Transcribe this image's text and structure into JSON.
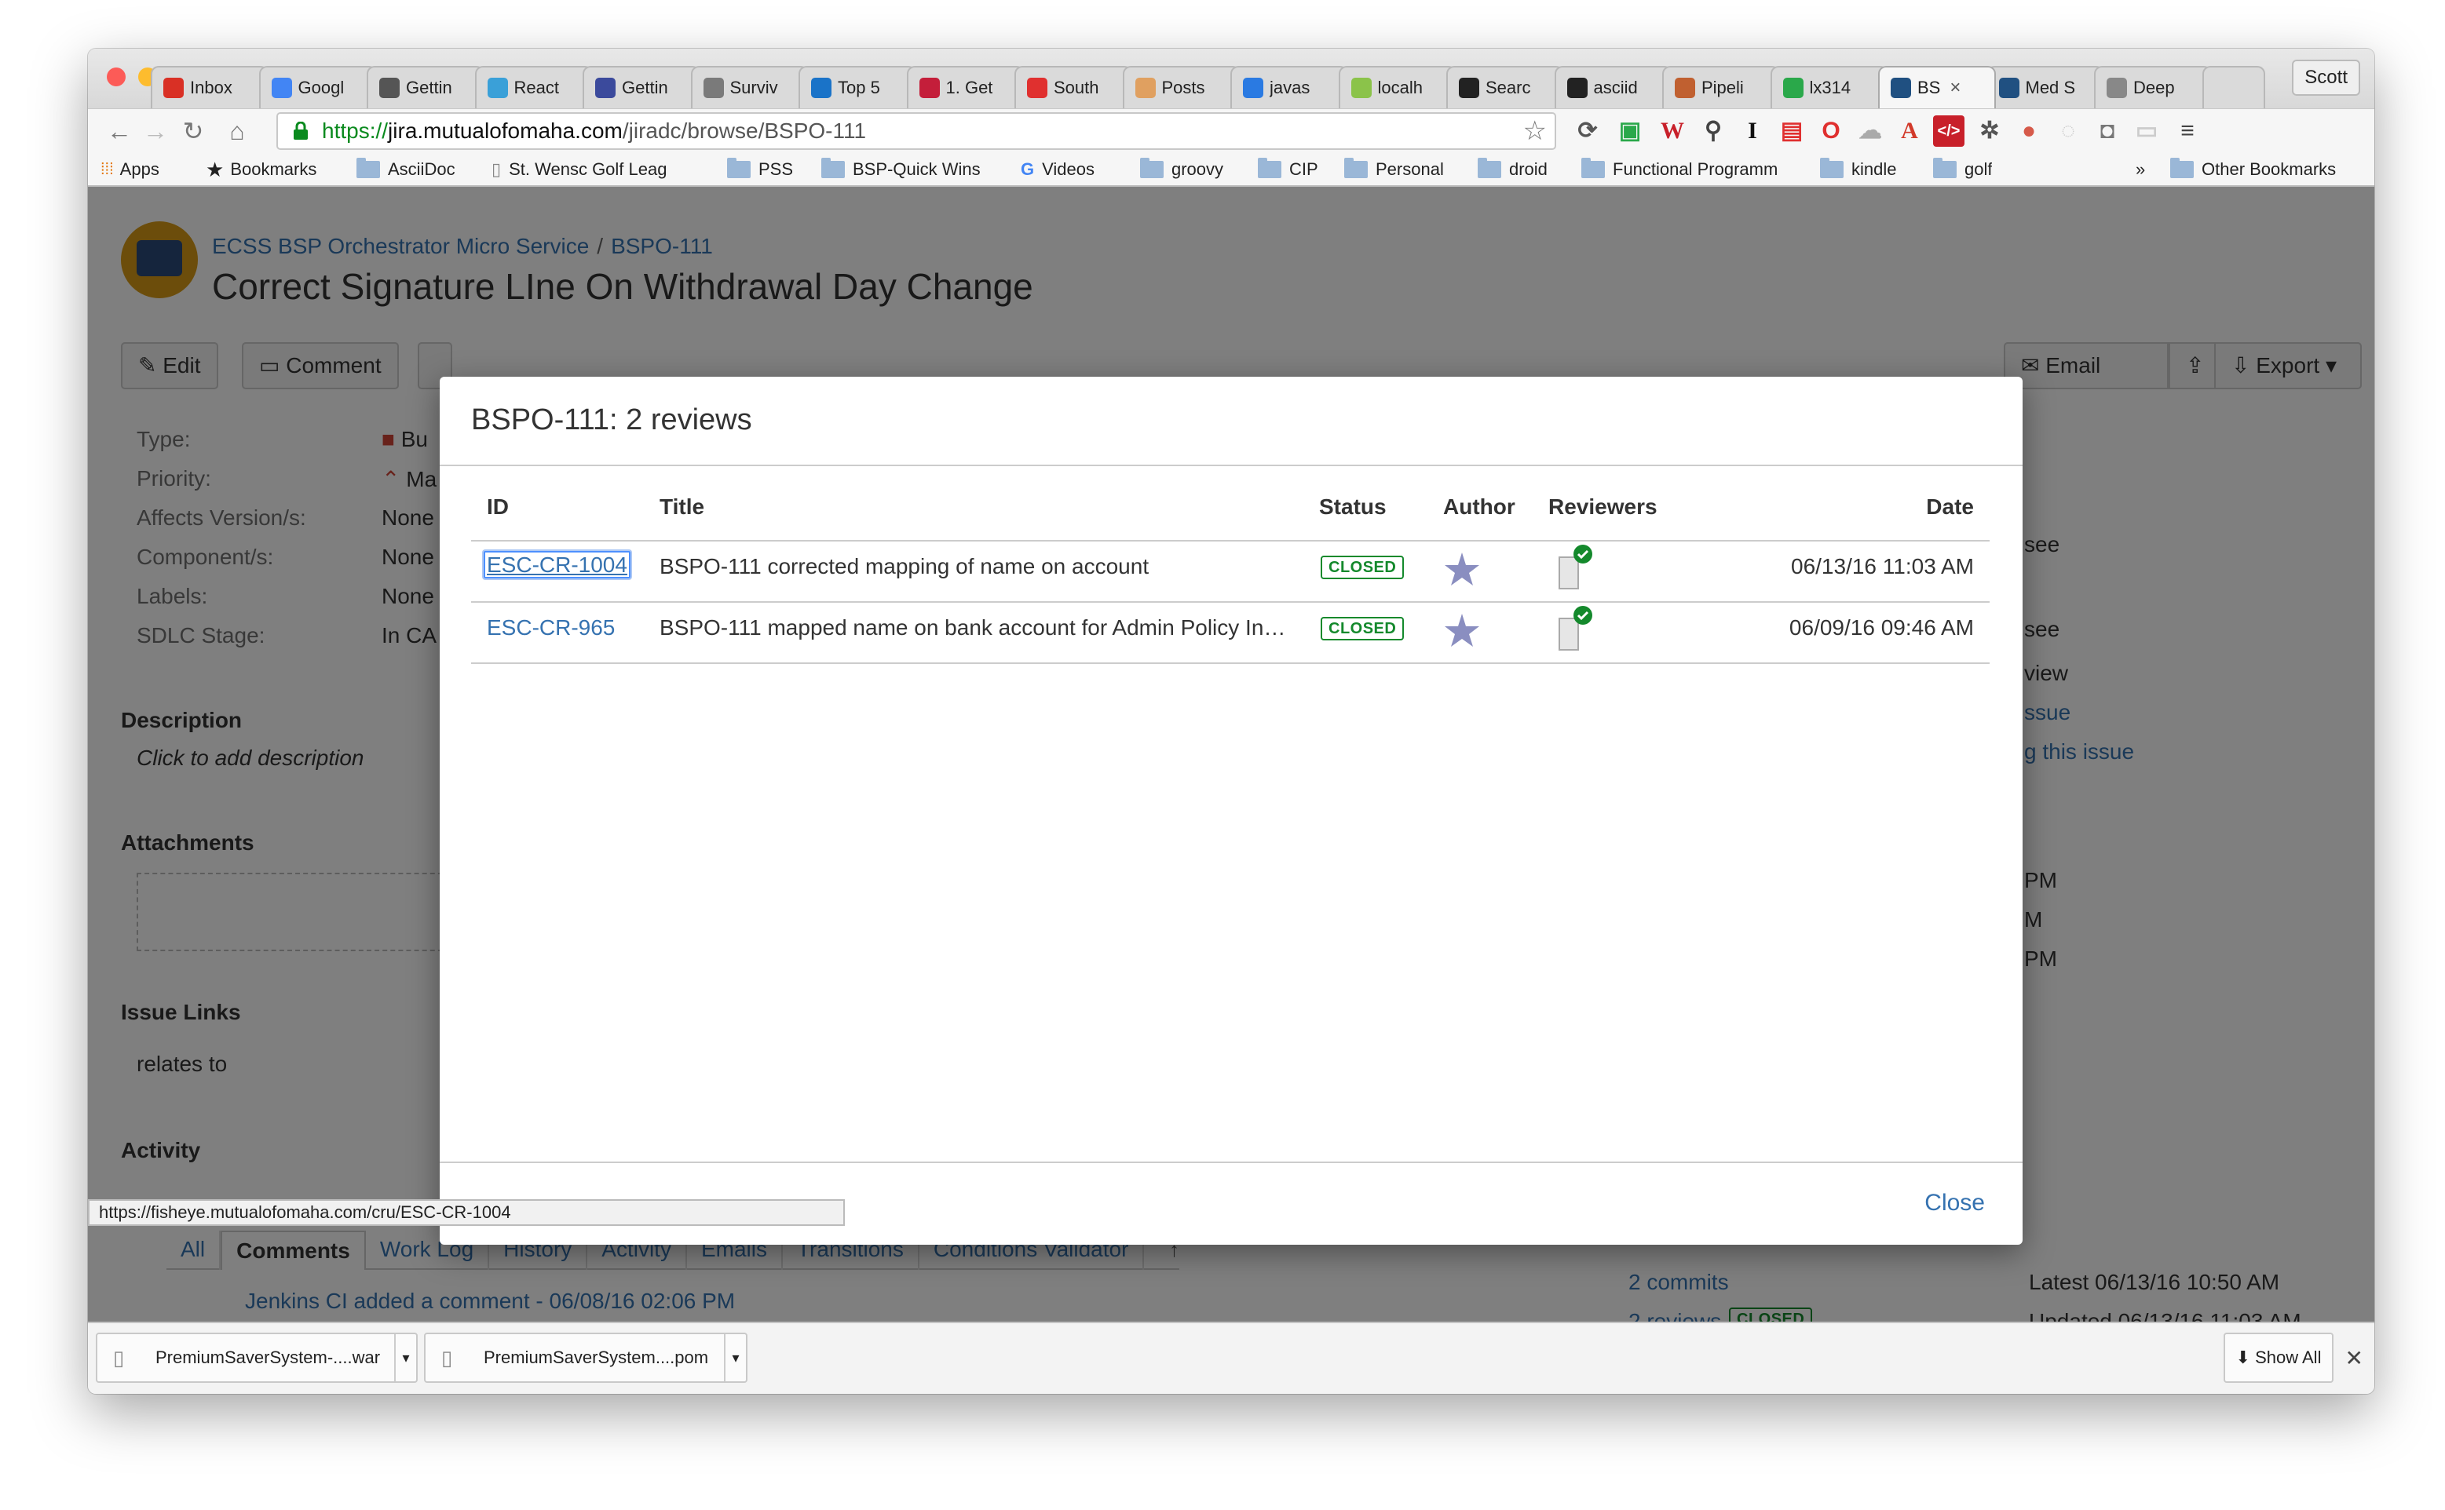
{
  "browser": {
    "profile_name": "Scott",
    "tabs": [
      {
        "label": "Inbox",
        "icon": "gmail-icon",
        "color": "#d93025"
      },
      {
        "label": "Googl",
        "icon": "calendar-icon",
        "color": "#4285f4"
      },
      {
        "label": "Gettin",
        "icon": "glasses-icon",
        "color": "#555555"
      },
      {
        "label": "React",
        "icon": "react-icon",
        "color": "#3aa0d8"
      },
      {
        "label": "Gettin",
        "icon": "s-icon",
        "color": "#3b4a9c"
      },
      {
        "label": "Surviv",
        "icon": "circle-icon",
        "color": "#7a7a7a"
      },
      {
        "label": "Top 5",
        "icon": "bird-icon",
        "color": "#1a73c8"
      },
      {
        "label": "1. Get",
        "icon": "dr-icon",
        "color": "#c41e3a"
      },
      {
        "label": "South",
        "icon": "heart-icon",
        "color": "#e0302f"
      },
      {
        "label": "Posts",
        "icon": "post-icon",
        "color": "#e0a060"
      },
      {
        "label": "javas",
        "icon": "f-icon",
        "color": "#2a7ae2"
      },
      {
        "label": "localh",
        "icon": "leaf-icon",
        "color": "#8bc34a"
      },
      {
        "label": "Searc",
        "icon": "github-icon",
        "color": "#222222"
      },
      {
        "label": "asciid",
        "icon": "github-icon",
        "color": "#222222"
      },
      {
        "label": "Pipeli",
        "icon": "jenkins-icon",
        "color": "#c06030"
      },
      {
        "label": "lx314",
        "icon": "ring-icon",
        "color": "#2aa84a"
      },
      {
        "label": "BS",
        "icon": "jira-icon",
        "color": "#205081",
        "active": true
      },
      {
        "label": "Med S",
        "icon": "globe-icon",
        "color": "#205081"
      },
      {
        "label": "Deep",
        "icon": "page-icon",
        "color": "#888888"
      }
    ],
    "url": {
      "protocol": "https://",
      "host": "jira.mutualofomaha.com",
      "path": "/jiradc/browse/BSPO-111"
    },
    "bookmarks": [
      "Apps",
      "Bookmarks",
      "AsciiDoc",
      "St. Wensc Golf Leag",
      "PSS",
      "BSP-Quick Wins",
      "Videos",
      "groovy",
      "CIP",
      "Personal",
      "droid",
      "Functional Programm",
      "kindle",
      "golf",
      "»",
      "Other Bookmarks"
    ],
    "status_url": "https://fisheye.mutualofomaha.com/cru/ESC-CR-1004"
  },
  "issue": {
    "project": "ECSS BSP Orchestrator Micro Service",
    "key": "BSPO-111",
    "title": "Correct Signature LIne On Withdrawal Day Change",
    "buttons": {
      "edit": "Edit",
      "comment": "Comment",
      "email": "Email",
      "export": "Export"
    },
    "fields": [
      {
        "label": "Type:",
        "value": "Bu"
      },
      {
        "label": "Priority:",
        "value": "Ma"
      },
      {
        "label": "Affects Version/s:",
        "value": "None"
      },
      {
        "label": "Component/s:",
        "value": "None"
      },
      {
        "label": "Labels:",
        "value": "None"
      },
      {
        "label": "SDLC Stage:",
        "value": "In CA"
      }
    ],
    "description_heading": "Description",
    "description_placeholder": "Click to add description",
    "attachments_heading": "Attachments",
    "issue_links_heading": "Issue Links",
    "relates_to": "relates to",
    "activity_heading": "Activity",
    "activity_tabs": [
      "All",
      "Comments",
      "Work Log",
      "History",
      "Activity",
      "Emails",
      "Transitions",
      "Conditions Validator"
    ],
    "activity_selected": "Comments",
    "comment_preview": "Jenkins CI added a comment - 06/08/16 02:06 PM",
    "right_panel": {
      "frag_see1": "see",
      "frag_see2": "see",
      "frag_view": "view",
      "frag_issue": "ssue",
      "frag_thisissue": "g this issue",
      "frag_pm1": "PM",
      "frag_m": "M",
      "frag_pm2": "PM",
      "commits": "2 commits",
      "reviews": "2 reviews",
      "reviews_status": "CLOSED",
      "latest": "Latest 06/13/16 10:50 AM",
      "updated": "Updated 06/13/16 11:03 AM"
    }
  },
  "dialog": {
    "title": "BSPO-111: 2 reviews",
    "columns": {
      "id": "ID",
      "title": "Title",
      "status": "Status",
      "author": "Author",
      "reviewers": "Reviewers",
      "date": "Date"
    },
    "rows": [
      {
        "id": "ESC-CR-1004",
        "title": "BSPO-111 corrected mapping of name on account",
        "status": "CLOSED",
        "date": "06/13/16 11:03 AM"
      },
      {
        "id": "ESC-CR-965",
        "title": "BSPO-111 mapped name on bank account for Admin Policy In…",
        "status": "CLOSED",
        "date": "06/09/16 09:46 AM"
      }
    ],
    "close_label": "Close"
  },
  "downloads": {
    "items": [
      "PremiumSaverSystem-....war",
      "PremiumSaverSystem....pom"
    ],
    "show_all": "Show All"
  }
}
